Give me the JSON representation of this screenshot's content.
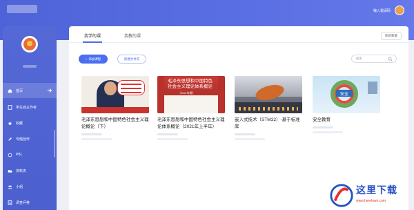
{
  "header": {
    "user_label": "输入邀请码"
  },
  "sidebar": {
    "items": [
      {
        "label": "首页",
        "icon": "home-icon",
        "active": true
      },
      {
        "label": "学生自主作考",
        "icon": "test-icon",
        "active": false
      },
      {
        "label": "收藏",
        "icon": "star-icon",
        "active": false
      },
      {
        "label": "专题创作",
        "icon": "edit-icon",
        "active": false
      },
      {
        "label": "PBL",
        "icon": "pbl-icon",
        "active": false
      },
      {
        "label": "资料夹",
        "icon": "folder-icon",
        "active": false
      },
      {
        "label": "小组",
        "icon": "group-icon",
        "active": false
      },
      {
        "label": "调查问卷",
        "icon": "survey-icon",
        "active": false
      }
    ]
  },
  "main": {
    "tabs": [
      {
        "label": "我学的课",
        "active": true
      },
      {
        "label": "我教的课",
        "active": false
      }
    ],
    "top_button": "体验新版",
    "add_course": "添加课程",
    "new_folder": "新建文件夹",
    "search_placeholder": "搜索",
    "courses": [
      {
        "title": "毛泽东思想和中国特色社会主义理论概论（下）"
      },
      {
        "title": "毛泽东思想和中国特色社会主义理论体系概论（2021年上半年）",
        "cover_text": "毛泽东思想和中国特色社会主义理论体系概论",
        "cover_sub": "（2021年版）"
      },
      {
        "title": "嵌入式技术（STM32）-基于标准库"
      },
      {
        "title": "安全教育",
        "cover_text": "安全"
      }
    ]
  },
  "watermark": {
    "text": "这里下载",
    "url": "www.herelown.com"
  },
  "colors": {
    "brand": "#4f63d8",
    "accent": "#4b6ef0"
  }
}
